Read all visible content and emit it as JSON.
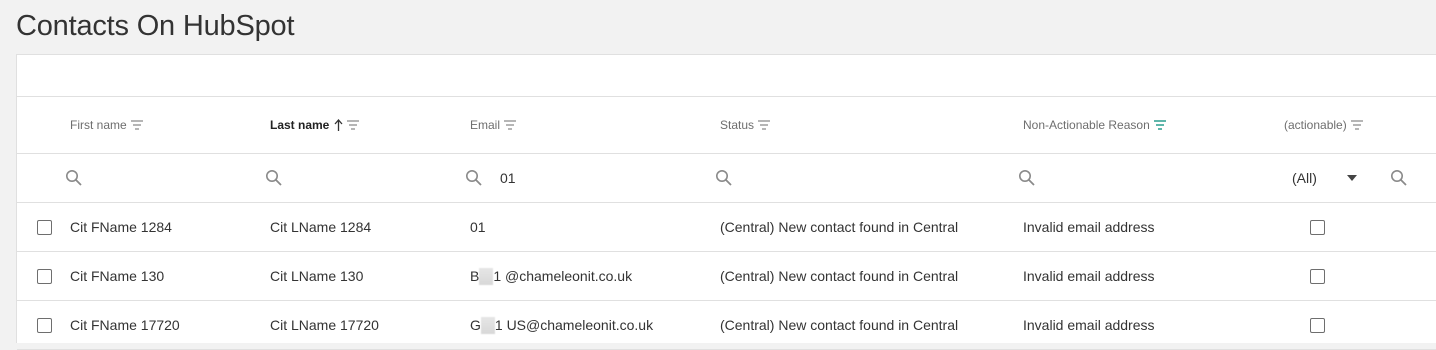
{
  "page": {
    "title": "Contacts On HubSpot"
  },
  "grid": {
    "columns": [
      {
        "label": "First name",
        "sorted": false,
        "filter_active": false
      },
      {
        "label": "Last name",
        "sorted": true,
        "sort_direction": "ascending",
        "filter_active": false
      },
      {
        "label": "Email",
        "sorted": false,
        "filter_active": false
      },
      {
        "label": "Status",
        "sorted": false,
        "filter_active": false
      },
      {
        "label": "Non-Actionable Reason",
        "sorted": false,
        "filter_active": true
      },
      {
        "label": "(actionable)",
        "sorted": false,
        "filter_active": false
      }
    ],
    "filters": {
      "email_value": "01",
      "actionable_select": {
        "value": "(All)"
      }
    },
    "rows": [
      {
        "first_name": "Cit FName 1284",
        "last_name": "Cit LName 1284",
        "email_prefix": "01",
        "email_suffix": "",
        "status": "(Central) New contact found in Central",
        "reason": "Invalid email address",
        "actionable": false
      },
      {
        "first_name": "Cit FName 130",
        "last_name": "Cit LName 130",
        "email_prefix": "B",
        "email_suffix": "1 @chameleonit.co.uk",
        "status": "(Central) New contact found in Central",
        "reason": "Invalid email address",
        "actionable": false
      },
      {
        "first_name": "Cit FName 17720",
        "last_name": "Cit LName 17720",
        "email_prefix": "G",
        "email_suffix": "1 US@chameleonit.co.uk",
        "status": "(Central) New contact found in Central",
        "reason": "Invalid email address",
        "actionable": false
      }
    ]
  },
  "colors": {
    "active_filter": "#2a9d8f",
    "icon_gray": "#8a8a8a",
    "border": "#e0e0e0"
  },
  "icons": {
    "filter": "filter-lines-icon",
    "sort_up": "arrow-up-icon",
    "search": "magnifier-icon",
    "dropdown": "caret-down-icon"
  }
}
